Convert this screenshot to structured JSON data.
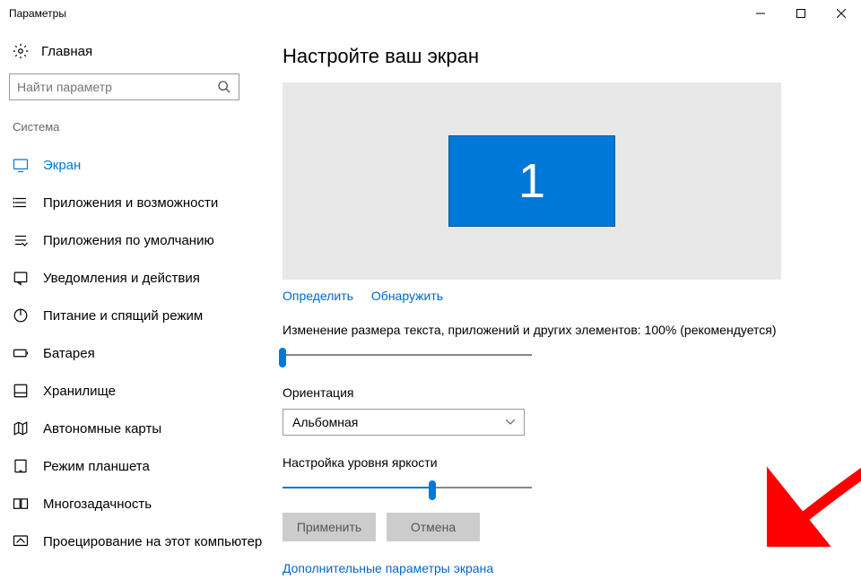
{
  "window": {
    "title": "Параметры"
  },
  "sidebar": {
    "home": "Главная",
    "search_placeholder": "Найти параметр",
    "section": "Система",
    "items": [
      {
        "label": "Экран",
        "icon": "display-icon",
        "active": true
      },
      {
        "label": "Приложения и возможности",
        "icon": "apps-icon"
      },
      {
        "label": "Приложения по умолчанию",
        "icon": "default-apps-icon"
      },
      {
        "label": "Уведомления и действия",
        "icon": "notifications-icon"
      },
      {
        "label": "Питание и спящий режим",
        "icon": "power-icon"
      },
      {
        "label": "Батарея",
        "icon": "battery-icon"
      },
      {
        "label": "Хранилище",
        "icon": "storage-icon"
      },
      {
        "label": "Автономные карты",
        "icon": "maps-icon"
      },
      {
        "label": "Режим планшета",
        "icon": "tablet-icon"
      },
      {
        "label": "Многозадачность",
        "icon": "multitask-icon"
      },
      {
        "label": "Проецирование на этот компьютер",
        "icon": "project-icon"
      }
    ]
  },
  "main": {
    "title": "Настройте ваш экран",
    "monitor_number": "1",
    "identify": "Определить",
    "detect": "Обнаружить",
    "scale_label": "Изменение размера текста, приложений и других элементов: 100% (рекомендуется)",
    "scale_value": 0,
    "orientation_label": "Ориентация",
    "orientation_value": "Альбомная",
    "brightness_label": "Настройка уровня яркости",
    "brightness_value": 60,
    "apply": "Применить",
    "cancel": "Отмена",
    "advanced_link": "Дополнительные параметры экрана"
  }
}
